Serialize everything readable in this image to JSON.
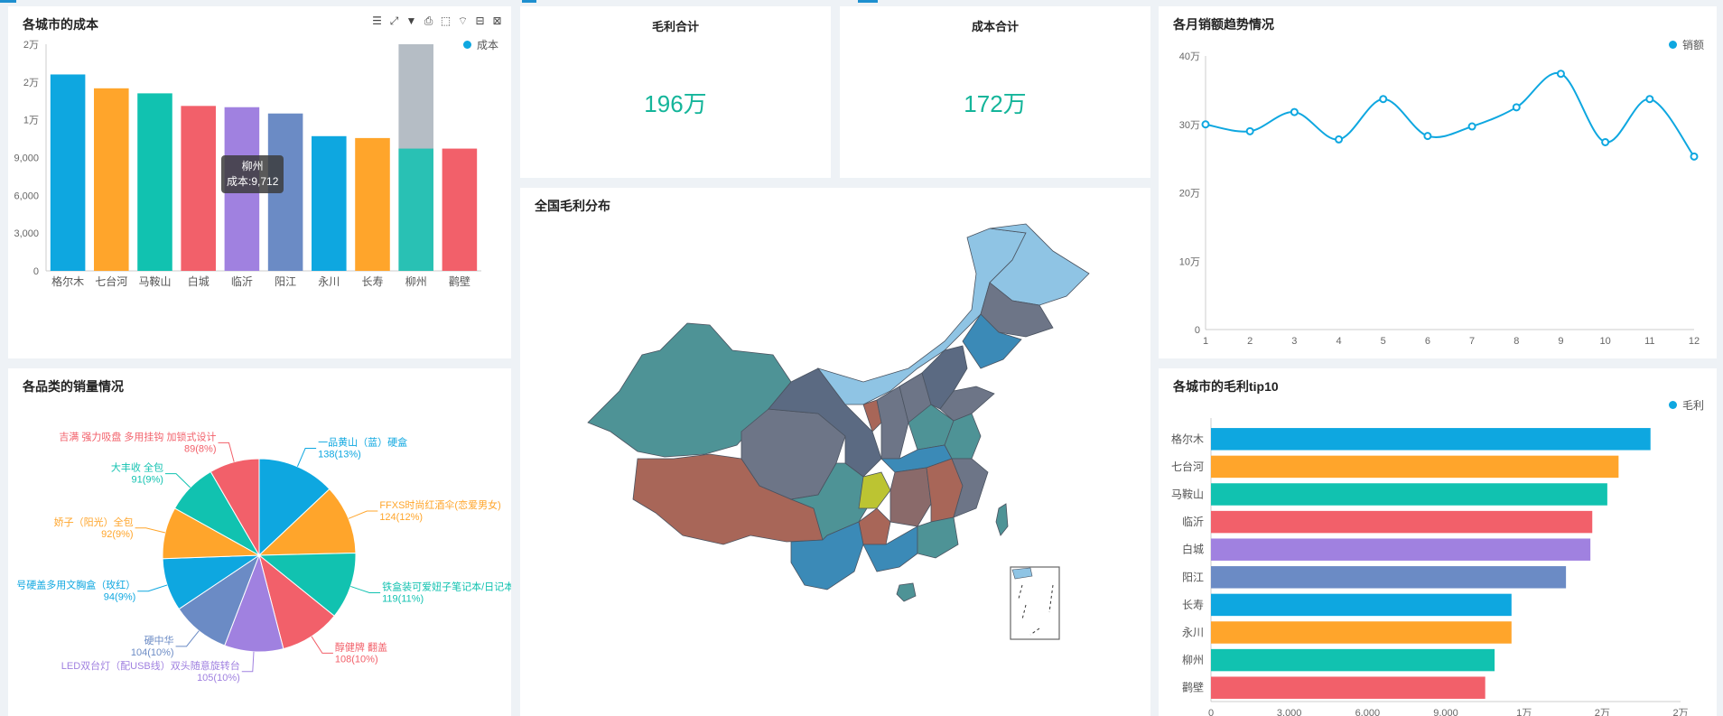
{
  "panels": {
    "city_cost": {
      "title": "各城市的成本",
      "legend": "成本",
      "toolbox_icons": [
        "data-view-icon",
        "zoom-icon",
        "filter-icon",
        "save-icon",
        "rect-select-icon",
        "lasso-icon",
        "restore-icon",
        "clear-icon"
      ],
      "tooltip": {
        "city": "柳州",
        "text": "成本:9,712"
      }
    },
    "gross_profit_total": {
      "title": "毛利合计",
      "value": "196万"
    },
    "cost_total": {
      "title": "成本合计",
      "value": "172万"
    },
    "monthly_sales": {
      "title": "各月销额趋势情况",
      "legend": "销额"
    },
    "national_profit": {
      "title": "全国毛利分布"
    },
    "category_sales": {
      "title": "各品类的销量情况"
    },
    "city_profit_top10": {
      "title": "各城市的毛利tip10",
      "legend": "毛利"
    }
  },
  "colors": {
    "blue": "#0ea7e0",
    "orange": "#ffa52b",
    "teal": "#11c2b0",
    "red": "#f2606a",
    "purple": "#a081e0",
    "steel": "#6b8bc5",
    "accent": "#14b59a"
  },
  "chart_data": [
    {
      "id": "city_cost",
      "type": "bar",
      "title": "各城市的成本",
      "categories": [
        "格尔木",
        "七台河",
        "马鞍山",
        "白城",
        "临沂",
        "阳江",
        "永川",
        "长寿",
        "柳州",
        "鹳壁"
      ],
      "series": [
        {
          "name": "成本",
          "values": [
            15600,
            14500,
            14100,
            13100,
            13000,
            12500,
            10700,
            10550,
            9712,
            9712
          ]
        }
      ],
      "ylim": [
        0,
        18000
      ],
      "yticks": [
        "0",
        "3,000",
        "6,000",
        "9,000",
        "1万",
        "2万",
        "2万"
      ],
      "highlight_index": 8
    },
    {
      "id": "monthly_sales",
      "type": "line",
      "title": "各月销额趋势情况",
      "x": [
        "1",
        "2",
        "3",
        "4",
        "5",
        "6",
        "7",
        "8",
        "9",
        "10",
        "11",
        "12"
      ],
      "series": [
        {
          "name": "销额",
          "values": [
            300000,
            290000,
            318000,
            278000,
            337000,
            283000,
            297000,
            325000,
            374000,
            274000,
            337000,
            253000
          ]
        }
      ],
      "ylim": [
        0,
        400000
      ],
      "yticks": [
        "0",
        "10万",
        "20万",
        "30万",
        "40万"
      ]
    },
    {
      "id": "category_sales",
      "type": "pie",
      "title": "各品类的销量情况",
      "slices": [
        {
          "label": "一品黄山（蓝）硬盒",
          "value": 138,
          "text": "138(13%)"
        },
        {
          "label": "FFXS时尚红酒伞(恋爱男女)",
          "value": 124,
          "text": "124(12%)"
        },
        {
          "label": "铁盒装可爱妞子笔记本/日记本",
          "value": 119,
          "text": "119(11%)"
        },
        {
          "label": "醇健牌 翻盖",
          "value": 108,
          "text": "108(10%)"
        },
        {
          "label": "LED双台灯（配USB线）双头随意旋转台",
          "value": 105,
          "text": "105(10%)"
        },
        {
          "label": "硬中华",
          "value": 104,
          "text": "104(10%)"
        },
        {
          "label": "号硬盖多用文胸盒（玫红）",
          "value": 94,
          "text": "94(9%)"
        },
        {
          "label": "娇子（阳光）全包",
          "value": 92,
          "text": "92(9%)"
        },
        {
          "label": "大丰收 全包",
          "value": 91,
          "text": "91(9%)"
        },
        {
          "label": "吉满 强力吸盘 多用挂钩 加锁式设计",
          "value": 89,
          "text": "89(8%)"
        }
      ]
    },
    {
      "id": "city_profit_top10",
      "type": "bar",
      "orientation": "horizontal",
      "title": "各城市的毛利tip10",
      "categories": [
        "格尔木",
        "七台河",
        "马鞍山",
        "临沂",
        "白城",
        "阳江",
        "长寿",
        "永川",
        "柳州",
        "鹳壁"
      ],
      "series": [
        {
          "name": "毛利",
          "values": [
            23400,
            21700,
            21100,
            20300,
            20200,
            18900,
            16000,
            16000,
            15100,
            14600
          ]
        }
      ],
      "xlim": [
        0,
        25000
      ],
      "xticks": [
        "0",
        "3,000",
        "6,000",
        "9,000",
        "1万",
        "2万",
        "2万"
      ]
    }
  ]
}
